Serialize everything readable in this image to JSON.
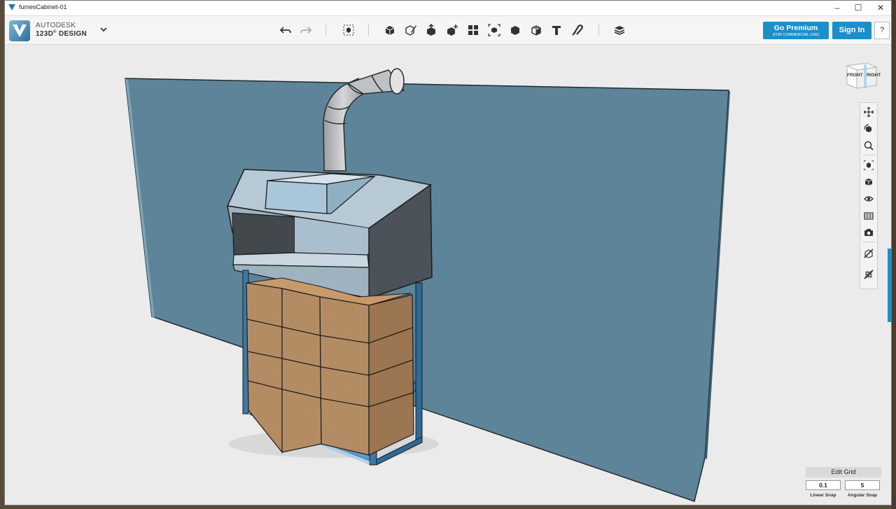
{
  "window": {
    "title": "fumesCabinet-01",
    "controls": {
      "minimize": "–",
      "maximize": "☐",
      "close": "✕"
    }
  },
  "brand": {
    "line1": "AUTODESK",
    "line2": "123D",
    "line3": "DESIGN"
  },
  "toolbar": {
    "tools": [
      "undo-icon",
      "redo-icon",
      "transform-icon",
      "primitives-icon",
      "sketch-icon",
      "construct-icon",
      "modify-icon",
      "pattern-icon",
      "group-icon",
      "combine-icon",
      "measure-icon",
      "text-icon",
      "snap-icon",
      "material-icon"
    ]
  },
  "premium": {
    "label": "Go Premium",
    "sub": "(FOR COMMERCIAL USE)"
  },
  "signin": {
    "label": "Sign In"
  },
  "help": {
    "label": "?"
  },
  "viewcube": {
    "front": "FRONT",
    "right": "RIGHT"
  },
  "grid": {
    "edit_label": "Edit Grid",
    "linear_snap": "0.1",
    "angular_snap": "5",
    "linear_label": "Linear Snap",
    "angular_label": "Angular Snap"
  },
  "colors": {
    "accent": "#1b8fc9",
    "wall": "#5e8499",
    "box": "#b38b63",
    "frame": "#3a79a8"
  }
}
